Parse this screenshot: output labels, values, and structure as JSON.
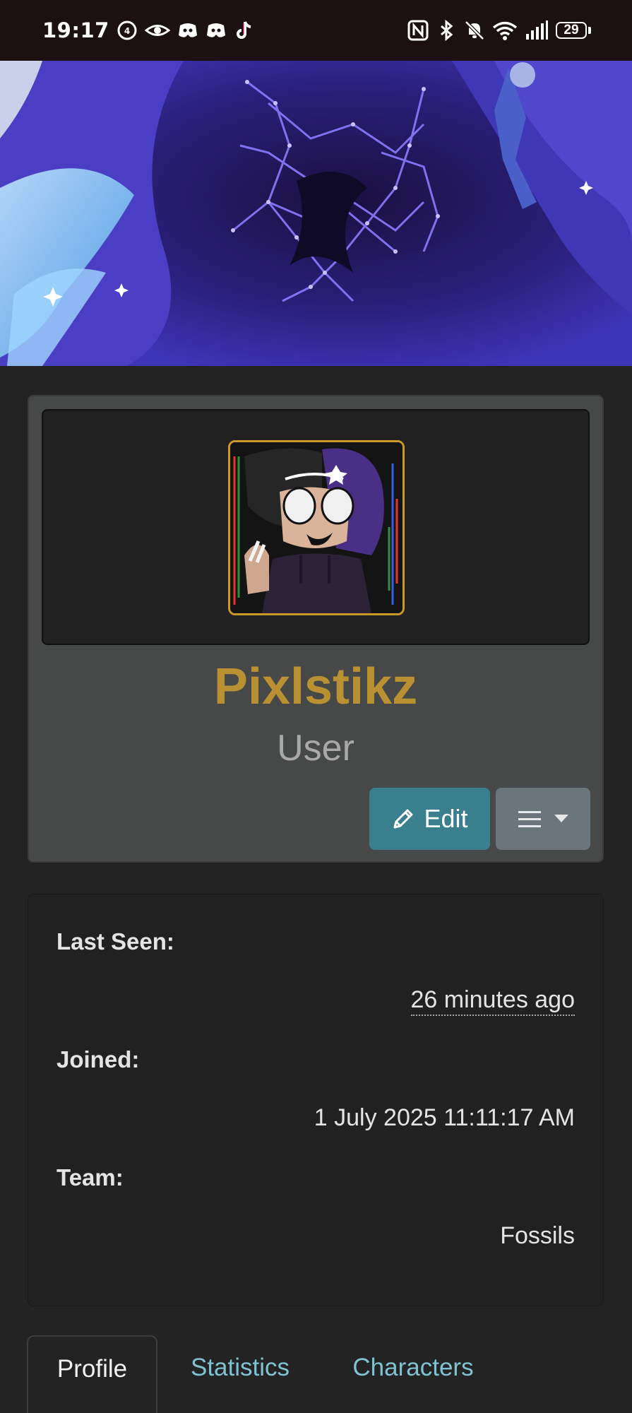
{
  "status_bar": {
    "time": "19:17",
    "battery": "29",
    "left_icons": [
      "accessibility-icon",
      "eye-icon",
      "discord-icon",
      "discord-icon",
      "tiktok-icon"
    ],
    "right_icons": [
      "nfc-icon",
      "bluetooth-icon",
      "bell-off-icon",
      "wifi-icon",
      "signal-icon",
      "battery-icon"
    ]
  },
  "profile": {
    "username": "Pixlstikz",
    "role": "User",
    "edit_label": "Edit",
    "username_color": "#b99132"
  },
  "info": {
    "last_seen_label": "Last Seen:",
    "last_seen_value": "26 minutes ago",
    "joined_label": "Joined:",
    "joined_value": "1 July 2025 11:11:17 AM",
    "team_label": "Team:",
    "team_value": "Fossils"
  },
  "tabs": [
    {
      "label": "Profile",
      "active": true
    },
    {
      "label": "Statistics",
      "active": false
    },
    {
      "label": "Characters",
      "active": false
    }
  ],
  "colors": {
    "accent_link": "#7fc3d3",
    "edit_button": "#3a7f8d",
    "menu_button": "#6b757c",
    "avatar_border": "#c99a28"
  }
}
